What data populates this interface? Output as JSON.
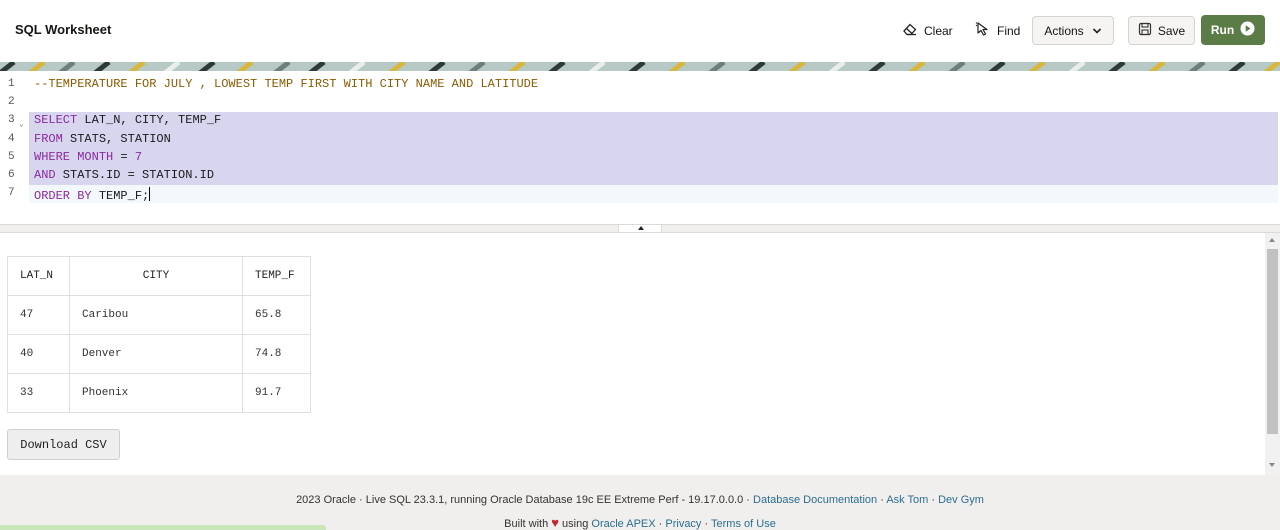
{
  "header": {
    "title": "SQL Worksheet",
    "clear_label": "Clear",
    "find_label": "Find",
    "actions_label": "Actions",
    "save_label": "Save",
    "run_label": "Run"
  },
  "editor": {
    "line_numbers": [
      "1",
      "2",
      "3",
      "4",
      "5",
      "6",
      "7"
    ],
    "lines": [
      "--TEMPERATURE FOR JULY , LOWEST TEMP FIRST WITH CITY NAME AND LATITUDE",
      "",
      "SELECT LAT_N, CITY, TEMP_F",
      "FROM STATS, STATION",
      "WHERE MONTH = 7",
      "AND STATS.ID = STATION.ID",
      "ORDER BY TEMP_F;"
    ],
    "tokens": {
      "select": "SELECT",
      "select_rest": " LAT_N, CITY, TEMP_F",
      "from": "FROM",
      "from_rest": " STATS, STATION",
      "where": "WHERE",
      "month": " MONTH",
      "eq": " = ",
      "seven": "7",
      "and": "AND",
      "and_rest": " STATS.ID = STATION.ID",
      "order": "ORDER",
      "by": " BY",
      "order_rest": " TEMP_F;"
    }
  },
  "results": {
    "columns": [
      "LAT_N",
      "CITY",
      "TEMP_F"
    ],
    "rows": [
      [
        "47",
        "Caribou",
        "65.8"
      ],
      [
        "40",
        "Denver",
        "74.8"
      ],
      [
        "33",
        "Phoenix",
        "91.7"
      ]
    ],
    "download_label": "Download CSV"
  },
  "footer": {
    "line1_text": "2023 Oracle · Live SQL 23.3.1, running Oracle Database 19c EE Extreme Perf - 19.17.0.0.0 · ",
    "link_docs": "Database Documentation",
    "sep1": " · ",
    "link_asktom": "Ask Tom",
    "sep2": " · ",
    "link_devgym": "Dev Gym",
    "built_with": "Built with ",
    "using": " using ",
    "link_apex": "Oracle APEX",
    "sep3": " · ",
    "link_privacy": "Privacy",
    "sep4": " · ",
    "link_terms": "Terms of Use"
  },
  "colors": {
    "run_button": "#5b7c46",
    "selection": "#d8d6ef",
    "keyword": "#8a2a9e",
    "comment": "#8a5a00",
    "link": "#2a6e90",
    "heart": "#c0262c"
  },
  "icons": [
    "eraser-icon",
    "find-cursor-icon",
    "chevron-down-icon",
    "save-icon",
    "play-icon",
    "heart-icon",
    "fold-arrow-icon"
  ]
}
